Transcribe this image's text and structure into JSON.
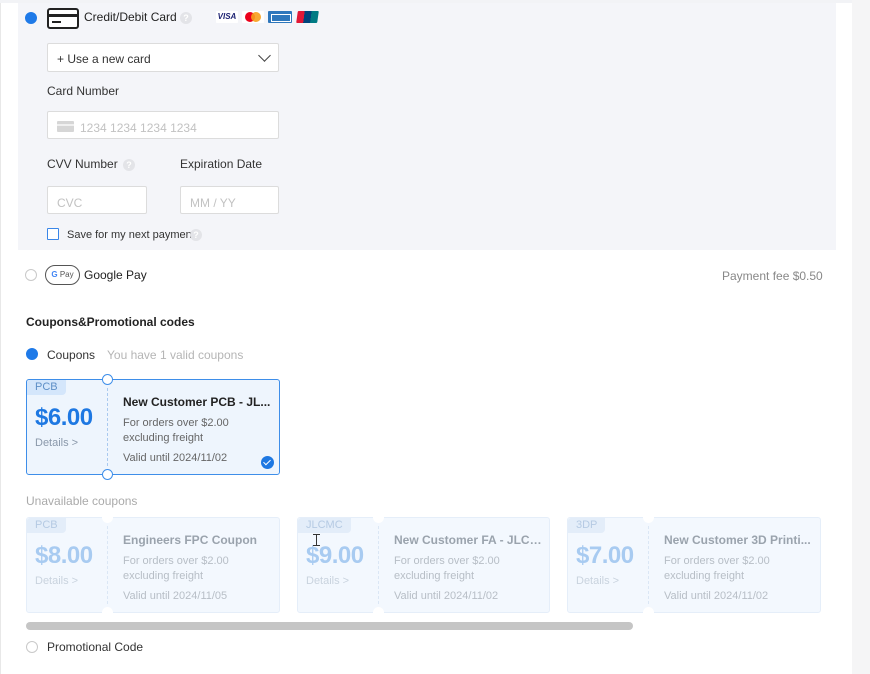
{
  "payment": {
    "card_option_label": "Credit/Debit Card",
    "card_brands": [
      "VISA",
      "Mastercard",
      "American Express",
      "UnionPay"
    ],
    "card_select_value": "+ Use a new card",
    "card_number_label": "Card Number",
    "card_number_placeholder": "1234 1234 1234 1234",
    "cvv_label": "CVV Number",
    "cvv_placeholder": "CVC",
    "expiry_label": "Expiration Date",
    "expiry_placeholder": "MM / YY",
    "save_label": "Save for my next payment",
    "gpay_badge": "Pay",
    "gpay_label": "Google Pay",
    "gpay_fee": "Payment fee $0.50"
  },
  "coupons_section": {
    "title": "Coupons&Promotional codes",
    "coupons_label": "Coupons",
    "coupons_hint": "You have 1 valid coupons",
    "available": [
      {
        "tag": "PCB",
        "amount": "$6.00",
        "details": "Details >",
        "title": "New Customer PCB - JL...",
        "desc": "For orders over $2.00 excluding freight",
        "valid": "Valid until 2024/11/02",
        "selected": true
      }
    ],
    "unavailable_label": "Unavailable coupons",
    "unavailable": [
      {
        "tag": "PCB",
        "amount": "$8.00",
        "details": "Details >",
        "title": "Engineers FPC Coupon",
        "desc": "For orders over $2.00 excluding freight",
        "valid": "Valid until 2024/11/05"
      },
      {
        "tag": "JLCMC",
        "amount": "$9.00",
        "details": "Details >",
        "title": "New Customer FA - JLCMC",
        "desc": "For orders over $2.00 excluding freight",
        "valid": "Valid until 2024/11/02"
      },
      {
        "tag": "3DP",
        "amount": "$7.00",
        "details": "Details >",
        "title": "New Customer 3D Printi...",
        "desc": "For orders over $2.00 excluding freight",
        "valid": "Valid until 2024/11/02"
      }
    ],
    "promo_label": "Promotional Code"
  },
  "colors": {
    "accent": "#1f7ae8",
    "panel_bg": "#f4f5f9"
  }
}
